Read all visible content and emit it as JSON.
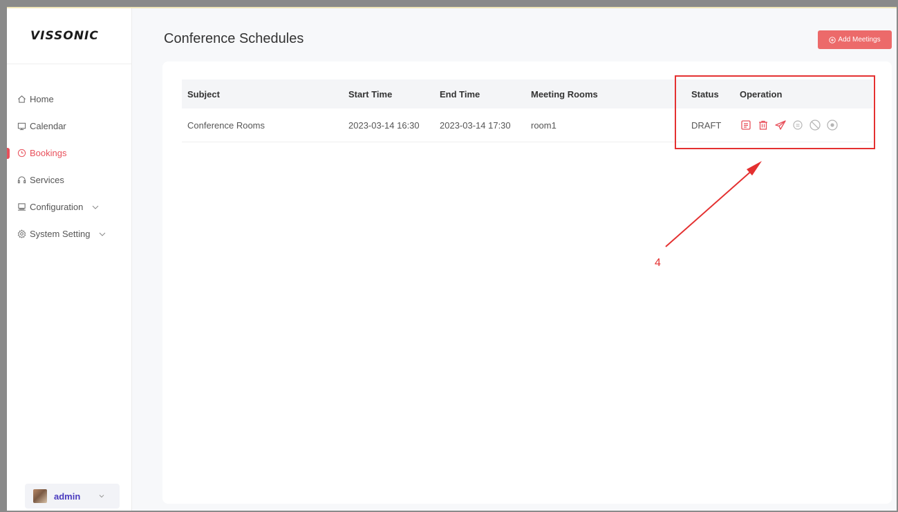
{
  "app": {
    "logo": "VISSONIC"
  },
  "sidebar": {
    "items": [
      {
        "label": "Home",
        "icon": "home-icon",
        "active": false
      },
      {
        "label": "Calendar",
        "icon": "calendar-icon",
        "active": false
      },
      {
        "label": "Bookings",
        "icon": "clock-icon",
        "active": true
      },
      {
        "label": "Services",
        "icon": "headset-icon",
        "active": false
      },
      {
        "label": "Configuration",
        "icon": "monitor-icon",
        "active": false,
        "expandable": true
      },
      {
        "label": "System Setting",
        "icon": "gear-icon",
        "active": false,
        "expandable": true
      }
    ]
  },
  "user": {
    "name": "admin"
  },
  "page": {
    "title": "Conference Schedules"
  },
  "toolbar": {
    "add_label": "Add Meetings"
  },
  "table": {
    "columns": [
      "Subject",
      "Start Time",
      "End Time",
      "Meeting Rooms",
      "Status",
      "Operation"
    ],
    "rows": [
      {
        "subject": "Conference Rooms",
        "start": "2023-03-14 16:30",
        "end": "2023-03-14 17:30",
        "room": "room1",
        "status": "DRAFT",
        "operations": [
          "details-icon",
          "delete-icon",
          "send-icon",
          "reschedule-icon",
          "cancel-icon",
          "end-icon"
        ]
      }
    ]
  },
  "annotation": {
    "label": "4"
  },
  "colors": {
    "accent": "#e8505b",
    "annotation": "#e43030",
    "button": "#ec6a6a"
  }
}
